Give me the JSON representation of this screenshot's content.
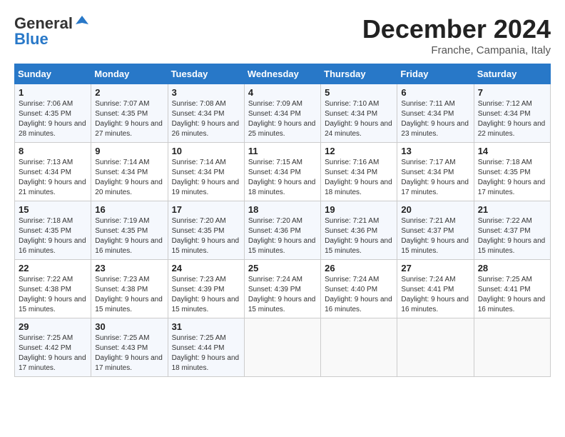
{
  "logo": {
    "general": "General",
    "blue": "Blue"
  },
  "header": {
    "month": "December 2024",
    "location": "Franche, Campania, Italy"
  },
  "weekdays": [
    "Sunday",
    "Monday",
    "Tuesday",
    "Wednesday",
    "Thursday",
    "Friday",
    "Saturday"
  ],
  "weeks": [
    [
      {
        "day": 1,
        "sunrise": "7:06 AM",
        "sunset": "4:35 PM",
        "daylight": "9 hours and 28 minutes."
      },
      {
        "day": 2,
        "sunrise": "7:07 AM",
        "sunset": "4:35 PM",
        "daylight": "9 hours and 27 minutes."
      },
      {
        "day": 3,
        "sunrise": "7:08 AM",
        "sunset": "4:34 PM",
        "daylight": "9 hours and 26 minutes."
      },
      {
        "day": 4,
        "sunrise": "7:09 AM",
        "sunset": "4:34 PM",
        "daylight": "9 hours and 25 minutes."
      },
      {
        "day": 5,
        "sunrise": "7:10 AM",
        "sunset": "4:34 PM",
        "daylight": "9 hours and 24 minutes."
      },
      {
        "day": 6,
        "sunrise": "7:11 AM",
        "sunset": "4:34 PM",
        "daylight": "9 hours and 23 minutes."
      },
      {
        "day": 7,
        "sunrise": "7:12 AM",
        "sunset": "4:34 PM",
        "daylight": "9 hours and 22 minutes."
      }
    ],
    [
      {
        "day": 8,
        "sunrise": "7:13 AM",
        "sunset": "4:34 PM",
        "daylight": "9 hours and 21 minutes."
      },
      {
        "day": 9,
        "sunrise": "7:14 AM",
        "sunset": "4:34 PM",
        "daylight": "9 hours and 20 minutes."
      },
      {
        "day": 10,
        "sunrise": "7:14 AM",
        "sunset": "4:34 PM",
        "daylight": "9 hours and 19 minutes."
      },
      {
        "day": 11,
        "sunrise": "7:15 AM",
        "sunset": "4:34 PM",
        "daylight": "9 hours and 18 minutes."
      },
      {
        "day": 12,
        "sunrise": "7:16 AM",
        "sunset": "4:34 PM",
        "daylight": "9 hours and 18 minutes."
      },
      {
        "day": 13,
        "sunrise": "7:17 AM",
        "sunset": "4:34 PM",
        "daylight": "9 hours and 17 minutes."
      },
      {
        "day": 14,
        "sunrise": "7:18 AM",
        "sunset": "4:35 PM",
        "daylight": "9 hours and 17 minutes."
      }
    ],
    [
      {
        "day": 15,
        "sunrise": "7:18 AM",
        "sunset": "4:35 PM",
        "daylight": "9 hours and 16 minutes."
      },
      {
        "day": 16,
        "sunrise": "7:19 AM",
        "sunset": "4:35 PM",
        "daylight": "9 hours and 16 minutes."
      },
      {
        "day": 17,
        "sunrise": "7:20 AM",
        "sunset": "4:35 PM",
        "daylight": "9 hours and 15 minutes."
      },
      {
        "day": 18,
        "sunrise": "7:20 AM",
        "sunset": "4:36 PM",
        "daylight": "9 hours and 15 minutes."
      },
      {
        "day": 19,
        "sunrise": "7:21 AM",
        "sunset": "4:36 PM",
        "daylight": "9 hours and 15 minutes."
      },
      {
        "day": 20,
        "sunrise": "7:21 AM",
        "sunset": "4:37 PM",
        "daylight": "9 hours and 15 minutes."
      },
      {
        "day": 21,
        "sunrise": "7:22 AM",
        "sunset": "4:37 PM",
        "daylight": "9 hours and 15 minutes."
      }
    ],
    [
      {
        "day": 22,
        "sunrise": "7:22 AM",
        "sunset": "4:38 PM",
        "daylight": "9 hours and 15 minutes."
      },
      {
        "day": 23,
        "sunrise": "7:23 AM",
        "sunset": "4:38 PM",
        "daylight": "9 hours and 15 minutes."
      },
      {
        "day": 24,
        "sunrise": "7:23 AM",
        "sunset": "4:39 PM",
        "daylight": "9 hours and 15 minutes."
      },
      {
        "day": 25,
        "sunrise": "7:24 AM",
        "sunset": "4:39 PM",
        "daylight": "9 hours and 15 minutes."
      },
      {
        "day": 26,
        "sunrise": "7:24 AM",
        "sunset": "4:40 PM",
        "daylight": "9 hours and 16 minutes."
      },
      {
        "day": 27,
        "sunrise": "7:24 AM",
        "sunset": "4:41 PM",
        "daylight": "9 hours and 16 minutes."
      },
      {
        "day": 28,
        "sunrise": "7:25 AM",
        "sunset": "4:41 PM",
        "daylight": "9 hours and 16 minutes."
      }
    ],
    [
      {
        "day": 29,
        "sunrise": "7:25 AM",
        "sunset": "4:42 PM",
        "daylight": "9 hours and 17 minutes."
      },
      {
        "day": 30,
        "sunrise": "7:25 AM",
        "sunset": "4:43 PM",
        "daylight": "9 hours and 17 minutes."
      },
      {
        "day": 31,
        "sunrise": "7:25 AM",
        "sunset": "4:44 PM",
        "daylight": "9 hours and 18 minutes."
      },
      null,
      null,
      null,
      null
    ]
  ]
}
